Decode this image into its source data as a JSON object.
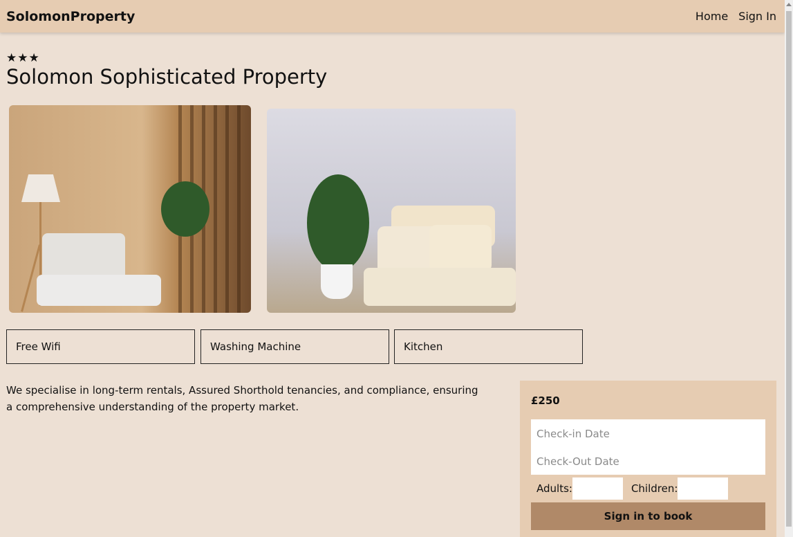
{
  "nav": {
    "brand": "SolomonProperty",
    "links": [
      "Home",
      "Sign In"
    ]
  },
  "property": {
    "stars": "★★★",
    "rating": 3,
    "title": "Solomon Sophisticated Property",
    "photos": [
      "living-room-wood-slats",
      "living-room-sofa"
    ],
    "amenities": [
      "Free Wifi",
      "Washing Machine",
      "Kitchen"
    ],
    "description": "We specialise in long-term rentals, Assured Shorthold tenancies, and compliance, ensuring a comprehensive understanding of the property market."
  },
  "booking": {
    "price": "£250",
    "checkin_placeholder": "Check-in Date",
    "checkout_placeholder": "Check-Out Date",
    "adults_label": "Adults:",
    "children_label": "Children:",
    "button_label": "Sign in to book"
  },
  "colors": {
    "background": "#ede0d4",
    "navbar": "#e6ccb2",
    "booking_panel": "#e6ccb2",
    "button": "#b08968"
  }
}
